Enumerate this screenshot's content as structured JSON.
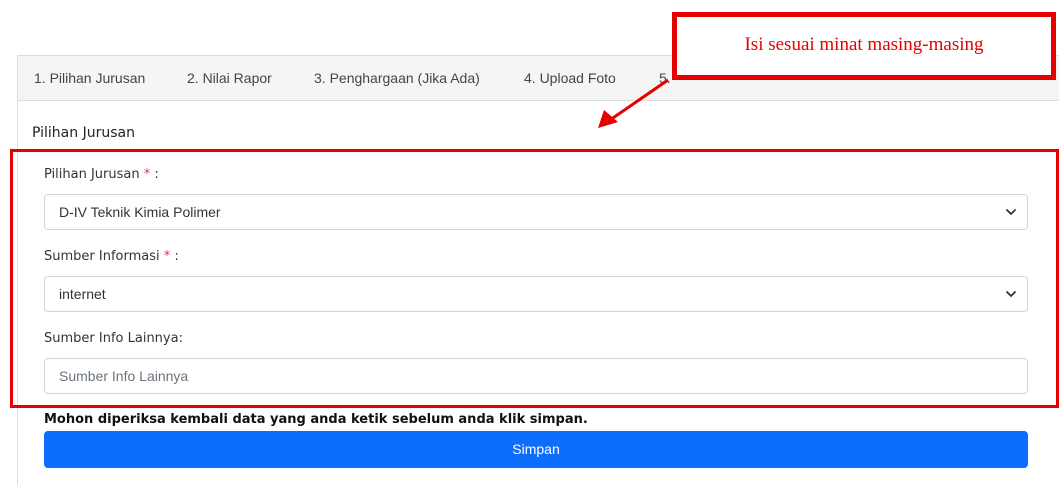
{
  "tabs": [
    {
      "label": "1. Pilihan Jurusan"
    },
    {
      "label": "2. Nilai Rapor"
    },
    {
      "label": "3. Penghargaan (Jika Ada)"
    },
    {
      "label": "4. Upload Foto"
    },
    {
      "label": "5."
    }
  ],
  "section": {
    "title": "Pilihan Jurusan"
  },
  "fields": {
    "jurusan": {
      "label": "Pilihan Jurusan",
      "required_mark": "*",
      "suffix": " :",
      "value": "D-IV Teknik Kimia Polimer",
      "icon": "chevron-down-icon"
    },
    "sumber_informasi": {
      "label": "Sumber Informasi",
      "required_mark": "*",
      "suffix": " :",
      "value": "internet",
      "icon": "chevron-down-icon"
    },
    "sumber_lainnya": {
      "label": "Sumber Info Lainnya:",
      "placeholder": "Sumber Info Lainnya",
      "value": ""
    }
  },
  "notice": "Mohon diperiksa kembali data yang anda ketik sebelum anda klik simpan.",
  "save_button": {
    "label": "Simpan"
  },
  "annotation": {
    "text": "Isi sesuai minat masing-masing"
  },
  "colors": {
    "primary": "#0d6efd",
    "required": "#dc3545",
    "annotation": "#e60000",
    "tab_background": "#f5f5f5"
  }
}
